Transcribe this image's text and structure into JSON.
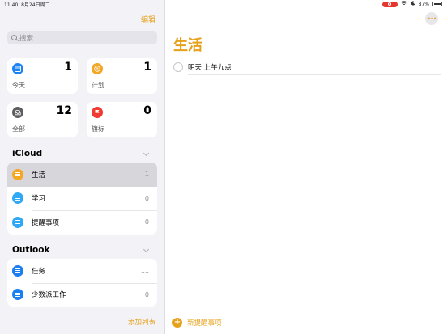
{
  "status": {
    "time": "11:40",
    "date": "8月24日周二",
    "battery": "87%"
  },
  "sidebar": {
    "edit_label": "编辑",
    "search_placeholder": "搜索",
    "smart_lists": [
      {
        "label": "今天",
        "count": "1",
        "color": "#1a84f5",
        "icon": "calendar-icon"
      },
      {
        "label": "计划",
        "count": "1",
        "color": "#f5a623",
        "icon": "clock-icon"
      },
      {
        "label": "全部",
        "count": "12",
        "color": "#5e5e63",
        "icon": "tray-icon"
      },
      {
        "label": "旗标",
        "count": "0",
        "color": "#ef3b31",
        "icon": "flag-icon"
      }
    ],
    "icloud": {
      "title": "iCloud",
      "lists": [
        {
          "label": "生活",
          "count": "1",
          "color": "#f5a623"
        },
        {
          "label": "学习",
          "count": "0",
          "color": "#2fa8f5"
        },
        {
          "label": "提醒事项",
          "count": "0",
          "color": "#2fa8f5"
        }
      ]
    },
    "outlook": {
      "title": "Outlook",
      "lists": [
        {
          "label": "任务",
          "count": "11",
          "color": "#1a7ff0"
        },
        {
          "label": "少数派工作",
          "count": "0",
          "color": "#1a7ff0"
        }
      ]
    },
    "add_list_label": "添加列表"
  },
  "main": {
    "title": "生活",
    "more_label": "•••",
    "tasks": [
      {
        "text": "明天 上午九点"
      }
    ],
    "new_reminder_label": "新提醒事项"
  },
  "colors": {
    "accent": "#e6a11a"
  }
}
